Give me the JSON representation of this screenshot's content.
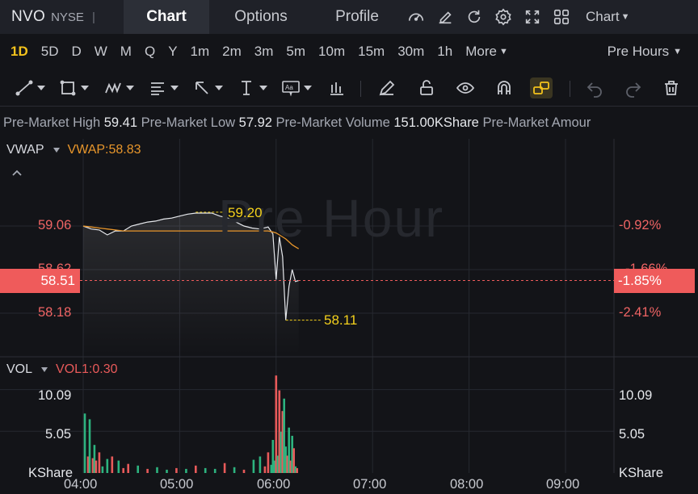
{
  "header": {
    "symbol": "NVO",
    "exchange": "NYSE",
    "separator": "|",
    "tabs": [
      {
        "label": "Chart",
        "active": true
      },
      {
        "label": "Options",
        "active": false
      },
      {
        "label": "Profile",
        "active": false
      }
    ],
    "icons": [
      "speedometer-icon",
      "edit-icon",
      "refresh-icon",
      "settings-icon",
      "fullscreen-icon",
      "grid-icon"
    ],
    "chart_menu": "Chart"
  },
  "timeframes": {
    "items": [
      "1D",
      "5D",
      "D",
      "W",
      "M",
      "Q",
      "Y",
      "1m",
      "2m",
      "3m",
      "5m",
      "10m",
      "15m",
      "30m",
      "1h"
    ],
    "active": "1D",
    "more": "More",
    "session": "Pre Hours"
  },
  "drawing_tools": [
    "line-tool-icon",
    "rectangle-tool-icon",
    "pattern-tool-icon",
    "fibonacci-tool-icon",
    "arrow-tool-icon",
    "measure-tool-icon",
    "text-tool-icon",
    "bars-tool-icon",
    "pencil-icon",
    "unlock-icon",
    "eye-icon",
    "magnet-icon",
    "link-icon",
    "undo-icon",
    "redo-icon",
    "trash-icon"
  ],
  "info": {
    "high_label": "Pre-Market High",
    "high_value": "59.41",
    "low_label": "Pre-Market Low",
    "low_value": "57.92",
    "volume_label": "Pre-Market Volume",
    "volume_value": "151.00KShare",
    "amount_label": "Pre-Market Amour"
  },
  "price_panel": {
    "indicator": "VWAP",
    "indicator_value": "VWAP:58.83",
    "watermark": "Pre Hour",
    "left_ticks": [
      "59.06",
      "58.62",
      "58.18"
    ],
    "right_ticks": [
      "-0.92%",
      "-1.66%",
      "-2.41%"
    ],
    "current_price": "58.51",
    "current_change": "-1.85%",
    "high_marker": "59.20",
    "low_marker": "58.11"
  },
  "volume_panel": {
    "indicator": "VOL",
    "indicator_value": "VOL1:0.30",
    "left_ticks": [
      "10.09",
      "5.05",
      "KShare"
    ],
    "right_ticks": [
      "10.09",
      "5.05",
      "KShare"
    ]
  },
  "time_axis": [
    "04:00",
    "05:00",
    "06:00",
    "07:00",
    "08:00",
    "09:00"
  ],
  "colors": {
    "up": "#2db37f",
    "down": "#e85a5a",
    "vwap": "#e8962b",
    "accent": "#f3c21c",
    "price_line": "#e6e8ec"
  },
  "chart_data": [
    {
      "type": "line",
      "title": "",
      "xlabel": "",
      "ylabel": "",
      "x": [
        "04:00",
        "04:05",
        "04:10",
        "04:15",
        "04:20",
        "04:25",
        "04:30",
        "04:35",
        "04:40",
        "04:45",
        "04:50",
        "04:55",
        "05:00",
        "05:05",
        "05:10",
        "05:15",
        "05:20",
        "05:25",
        "05:30",
        "05:35",
        "05:40",
        "05:45",
        "05:50",
        "05:55",
        "05:58",
        "06:00",
        "06:02",
        "06:04",
        "06:06",
        "06:08",
        "06:10",
        "06:12",
        "06:14"
      ],
      "series": [
        {
          "name": "",
          "values": [
            59.06,
            59.03,
            59.02,
            58.97,
            59.01,
            59.01,
            59.06,
            59.08,
            59.1,
            59.11,
            59.13,
            59.14,
            59.16,
            59.18,
            59.19,
            59.19,
            59.19,
            59.16,
            59.14,
            59.1,
            59.06,
            59.04,
            59.03,
            59.05,
            58.98,
            58.52,
            58.95,
            58.75,
            58.11,
            58.45,
            58.62,
            58.5,
            58.51
          ]
        },
        {
          "name": "VWAP",
          "values": [
            59.06,
            59.05,
            59.04,
            59.03,
            59.02,
            59.01,
            59.01,
            59.01,
            59.01,
            59.01,
            59.01,
            59.01,
            59.01,
            59.01,
            59.01,
            59.01,
            59.01,
            59.01,
            59.01,
            59.01,
            59.01,
            59.01,
            59.01,
            59.01,
            59.0,
            58.99,
            58.97,
            58.95,
            58.93,
            58.9,
            58.87,
            58.85,
            58.83
          ]
        }
      ],
      "ylim": [
        57.95,
        59.45
      ],
      "grid": true
    },
    {
      "type": "bar",
      "title": "",
      "xlabel": "",
      "ylabel": "KShare",
      "categories": [
        "04:01",
        "04:03",
        "04:04",
        "04:06",
        "04:07",
        "04:08",
        "04:10",
        "04:12",
        "04:15",
        "04:18",
        "04:22",
        "04:25",
        "04:28",
        "04:34",
        "04:40",
        "04:46",
        "04:52",
        "04:58",
        "05:04",
        "05:10",
        "05:16",
        "05:22",
        "05:28",
        "05:34",
        "05:40",
        "05:46",
        "05:50",
        "05:53",
        "05:55",
        "05:57",
        "05:58",
        "05:59",
        "06:00",
        "06:01",
        "06:02",
        "06:03",
        "06:04",
        "06:05",
        "06:06",
        "06:07",
        "06:08",
        "06:09",
        "06:10",
        "06:11",
        "06:12",
        "06:13"
      ],
      "series": [
        {
          "name": "",
          "values": [
            7.2,
            2.0,
            6.5,
            1.8,
            3.4,
            1.5,
            2.5,
            0.8,
            1.7,
            2.0,
            1.5,
            0.6,
            1.1,
            0.9,
            0.5,
            0.7,
            0.4,
            0.6,
            0.5,
            0.9,
            0.6,
            0.5,
            1.2,
            0.7,
            0.4,
            1.6,
            2.0,
            0.8,
            2.5,
            1.0,
            4.0,
            1.5,
            11.8,
            2.1,
            10.0,
            5.0,
            7.5,
            9.0,
            3.2,
            2.1,
            5.5,
            1.5,
            4.5,
            3.0,
            0.8,
            0.6
          ]
        }
      ],
      "bar_colors": [
        "up",
        "down",
        "up",
        "down",
        "up",
        "down",
        "down",
        "up",
        "up",
        "down",
        "up",
        "down",
        "down",
        "up",
        "down",
        "up",
        "up",
        "down",
        "up",
        "down",
        "up",
        "up",
        "down",
        "up",
        "down",
        "up",
        "up",
        "down",
        "down",
        "up",
        "up",
        "up",
        "down",
        "up",
        "down",
        "up",
        "down",
        "up",
        "up",
        "down",
        "up",
        "down",
        "up",
        "down",
        "up",
        "down"
      ],
      "ylim": [
        0,
        12.5
      ],
      "grid": true
    }
  ]
}
